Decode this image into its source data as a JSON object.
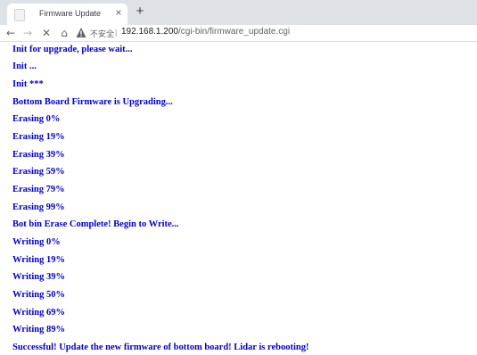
{
  "browser": {
    "tab": {
      "title": "Firmware Update",
      "close_label": "×",
      "new_tab_label": "+"
    },
    "toolbar": {
      "back_icon": "←",
      "forward_icon": "→",
      "stop_icon": "✕",
      "home_icon": "⌂",
      "security_text": "不安全",
      "separator": "|",
      "url_host": "192.168.1.200",
      "url_path": "/cgi-bin/firmware_update.cgi"
    }
  },
  "page": {
    "text_color": "#0000cc",
    "lines": [
      "Init for upgrade, please wait...",
      "Init ...",
      "Init ***",
      "Bottom Board Firmware is Upgrading...",
      "Erasing 0%",
      "Erasing 19%",
      "Erasing 39%",
      "Erasing 59%",
      "Erasing 79%",
      "Erasing 99%",
      "Bot bin Erase Complete! Begin to Write...",
      "Writing 0%",
      "Writing 19%",
      "Writing 39%",
      "Writing 50%",
      "Writing 69%",
      "Writing 89%",
      "Successful! Update the new firmware of bottom board! Lidar is rebooting!"
    ]
  }
}
